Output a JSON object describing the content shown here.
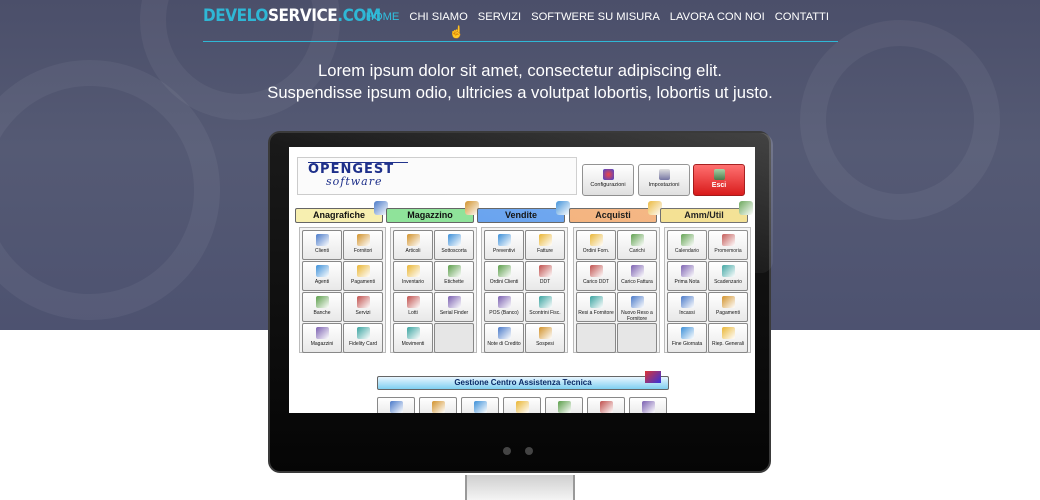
{
  "header": {
    "logo": {
      "part1": "DEVELO",
      "part2": "SERVICE",
      "part3": ".COM"
    },
    "nav": [
      {
        "label": "HOME",
        "active": true
      },
      {
        "label": "CHI SIAMO"
      },
      {
        "label": "SERVIZI"
      },
      {
        "label": "SOFTWERE SU MISURA"
      },
      {
        "label": "LAVORA CON NOI"
      },
      {
        "label": "CONTATTI"
      }
    ]
  },
  "hero": {
    "line1": "Lorem ipsum dolor sit amet, consectetur adipiscing elit.",
    "line2": "Suspendisse ipsum odio, ultricies a volutpat lobortis, lobortis ut justo."
  },
  "colors": {
    "accent": "#2fb7d5",
    "hero_bg": "#4f546f",
    "esci": "#e00000"
  },
  "app": {
    "logo_main": "OPENGEST",
    "logo_sub": "software",
    "top_buttons": [
      {
        "label": "Configurazioni",
        "icon": "config-icon"
      },
      {
        "label": "Impostazioni",
        "icon": "settings-icon"
      },
      {
        "label": "Esci",
        "icon": "exit-icon"
      }
    ],
    "sections": [
      {
        "label": "Anagrafiche",
        "color": "#f7efb0",
        "items": [
          "Clienti",
          "Fornitori",
          "Agenti",
          "Pagamenti",
          "Banche",
          "Servizi",
          "Magazzini",
          "Fidelity Card"
        ]
      },
      {
        "label": "Magazzino",
        "color": "#8fe39a",
        "items": [
          "Articoli",
          "Sottoscorta",
          "Inventario",
          "Etichette",
          "Lotti",
          "Serial Finder",
          "Movimenti",
          ""
        ]
      },
      {
        "label": "Vendite",
        "color": "#6aa4ef",
        "items": [
          "Preventivi",
          "Fatture",
          "Ordini Clienti",
          "DDT",
          "POS (Banco)",
          "Scontrini Fisc.",
          "Note di Credito",
          "Sospesi"
        ]
      },
      {
        "label": "Acquisti",
        "color": "#f4b27c",
        "items": [
          "Ordini Forn.",
          "Carichi",
          "Carico DDT",
          "Carico Fattura",
          "Resi a Fornitore",
          "Nuovo Reso a Fornitore",
          "",
          ""
        ]
      },
      {
        "label": "Amm/Util",
        "color": "#f3df8c",
        "items": [
          "Calendario",
          "Promemoria",
          "Prima Nota",
          "Scadenzario",
          "Incassi",
          "Pagamenti",
          "Fine Giornata",
          "Riep. Generali"
        ]
      }
    ],
    "gca": {
      "label": "Gestione Centro Assistenza Tecnica",
      "items": [
        "",
        "",
        "",
        "",
        "",
        "",
        ""
      ]
    }
  }
}
